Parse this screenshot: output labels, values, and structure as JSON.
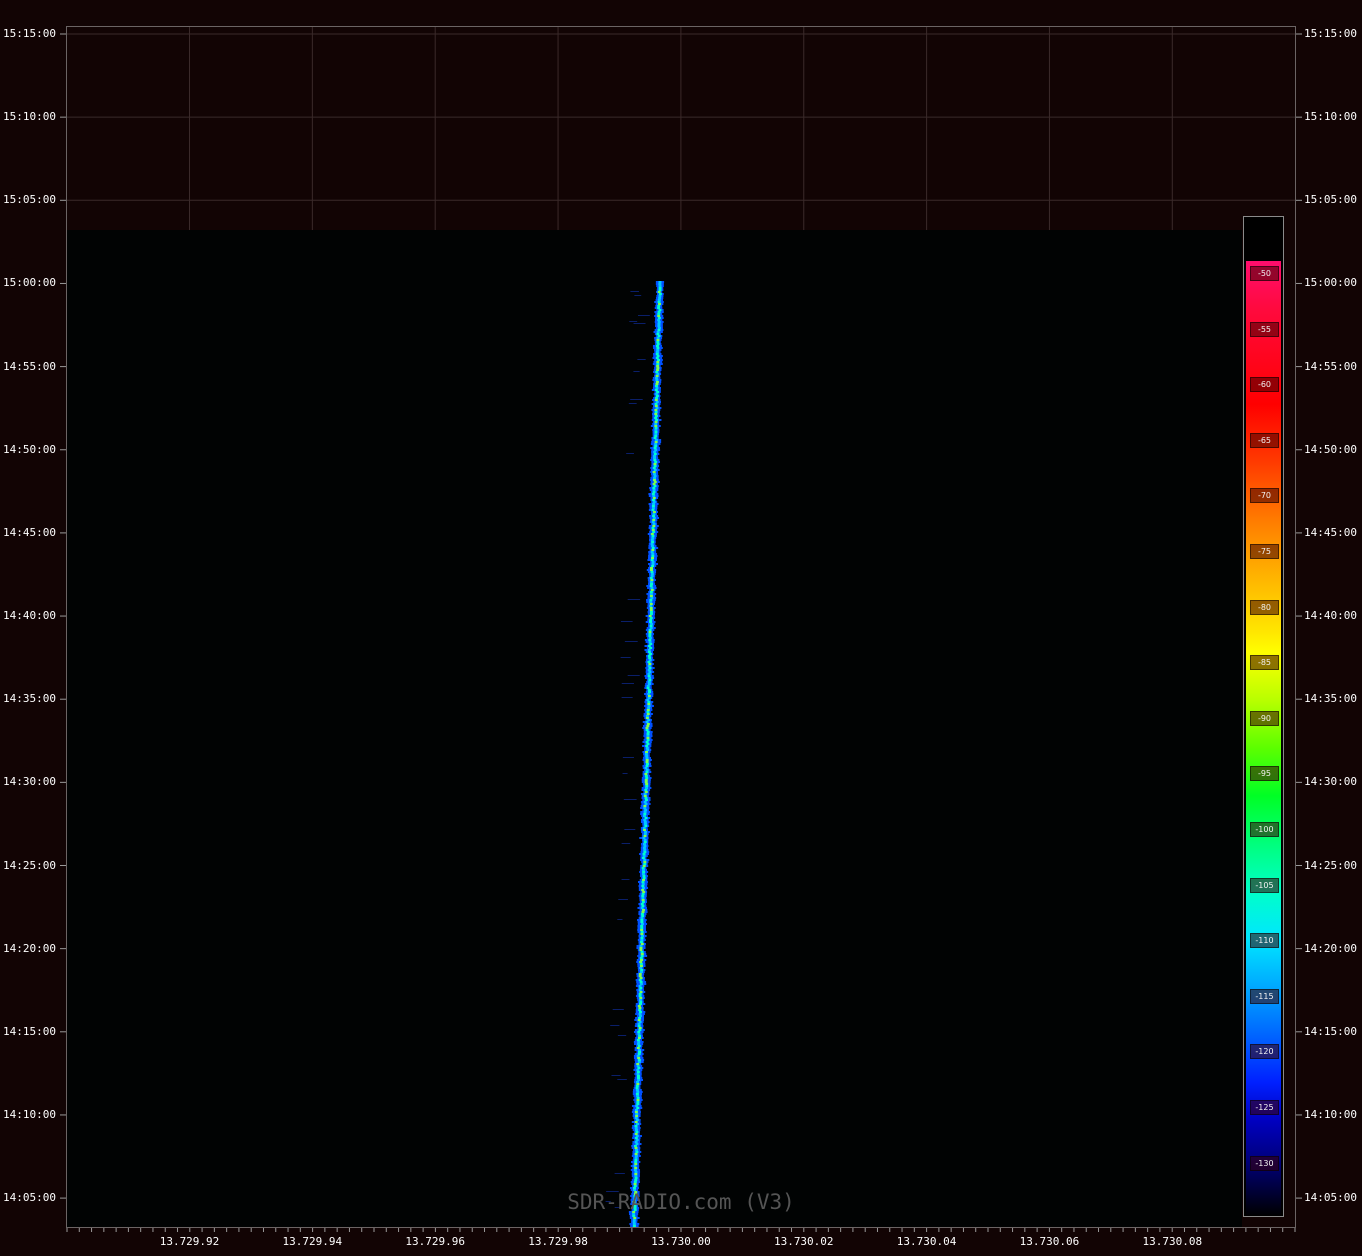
{
  "time_axis": {
    "labels": [
      "15:15:00",
      "15:10:00",
      "15:05:00",
      "15:00:00",
      "14:55:00",
      "14:50:00",
      "14:45:00",
      "14:40:00",
      "14:35:00",
      "14:30:00",
      "14:25:00",
      "14:20:00",
      "14:15:00",
      "14:10:00",
      "14:05:00"
    ]
  },
  "frequency_axis": {
    "labels": [
      "13.729.92",
      "13.729.94",
      "13.729.96",
      "13.729.98",
      "13.730.00",
      "13.730.02",
      "13.730.04",
      "13.730.06",
      "13.730.08"
    ]
  },
  "color_scale": {
    "unit_labels": [
      "-50",
      "-55",
      "-60",
      "-65",
      "-70",
      "-75",
      "-80",
      "-85",
      "-90",
      "-95",
      "-100",
      "-105",
      "-110",
      "-115",
      "-120",
      "-125",
      "-130"
    ]
  },
  "signal_trace": {
    "description_points": [
      {
        "time": "15:00:00",
        "freq": 13.729963
      },
      {
        "time": "14:40:00",
        "freq": 13.729952
      },
      {
        "time": "14:20:00",
        "freq": 13.729941
      },
      {
        "time": "14:03:00",
        "freq": 13.729933
      }
    ]
  },
  "watermark": "SDR-RADIO.com (V3)",
  "colors": {
    "background": "#120404",
    "waterfall_background": "#010303",
    "grid": "#3a2a2a",
    "trace_core": "#00ffcc",
    "trace_edge": "#0050ff"
  }
}
